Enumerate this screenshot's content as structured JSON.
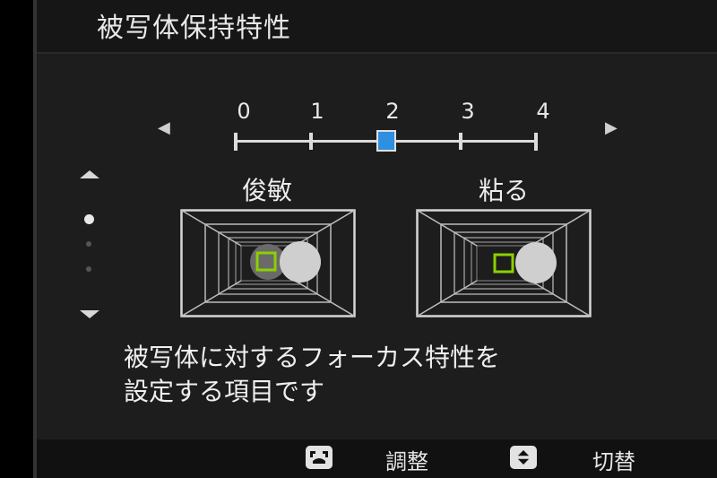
{
  "title": "被写体保持特性",
  "scale": {
    "labels": [
      "0",
      "1",
      "2",
      "3",
      "4"
    ],
    "selected_value": 2,
    "max_value": 4
  },
  "modes": {
    "left_label": "俊敏",
    "right_label": "粘る"
  },
  "page_indicator": {
    "current_page": 1,
    "total_pages": 3
  },
  "description": {
    "line1": "被写体に対するフォーカス特性を",
    "line2": "設定する項目です"
  },
  "footer": {
    "adjust_label": "調整",
    "adjust_icon": "dial-icon",
    "switch_label": "切替",
    "switch_icon": "up-down-button-icon"
  },
  "colors": {
    "slider_thumb": "#2f8fe0",
    "focus_frame": "#8cd000",
    "subject": "#cfcfcf"
  }
}
